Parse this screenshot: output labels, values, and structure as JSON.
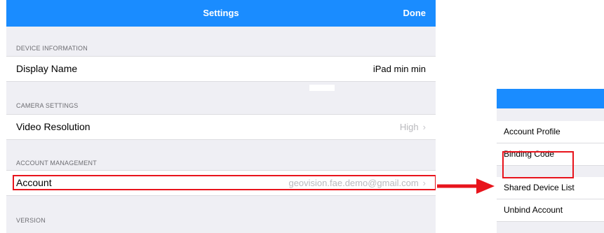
{
  "navbar": {
    "title": "Settings",
    "done_label": "Done"
  },
  "sections": {
    "device_information": {
      "header": "DEVICE INFORMATION",
      "display_name_label": "Display Name",
      "display_name_value": "iPad min min"
    },
    "camera_settings": {
      "header": "CAMERA SETTINGS",
      "video_resolution_label": "Video Resolution",
      "video_resolution_value": "High"
    },
    "account_management": {
      "header": "ACCOUNT MANAGEMENT",
      "account_label": "Account",
      "account_value": "geovision.fae.demo@gmail.com"
    },
    "version": {
      "header": "VERSION"
    }
  },
  "account_panel": {
    "items": [
      {
        "label": "Account Profile"
      },
      {
        "label": "Binding Code"
      },
      {
        "label": "Shared Device List"
      },
      {
        "label": "Unbind Account"
      }
    ]
  },
  "colors": {
    "nav_blue": "#1a8cff",
    "highlight_red": "#e8141c",
    "group_background": "#efeff4"
  },
  "icons": {
    "chevron": "chevron-right-icon",
    "arrow": "arrow-right-icon"
  }
}
